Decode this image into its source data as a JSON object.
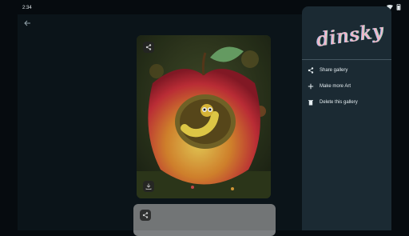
{
  "status_bar": {
    "time": "2:34"
  },
  "app": {
    "brand": "dinsky",
    "drawer_menu": [
      {
        "label": "Share gallery",
        "icon": "share-icon"
      },
      {
        "label": "Make more Art",
        "icon": "plus-icon"
      },
      {
        "label": "Delete this gallery",
        "icon": "trash-icon"
      }
    ]
  },
  "colors": {
    "drawer_bg": "#1b2a33",
    "app_bg": "#0c161c",
    "accent_pink": "#f6b4c8",
    "accent_green": "#a4d7b9"
  }
}
